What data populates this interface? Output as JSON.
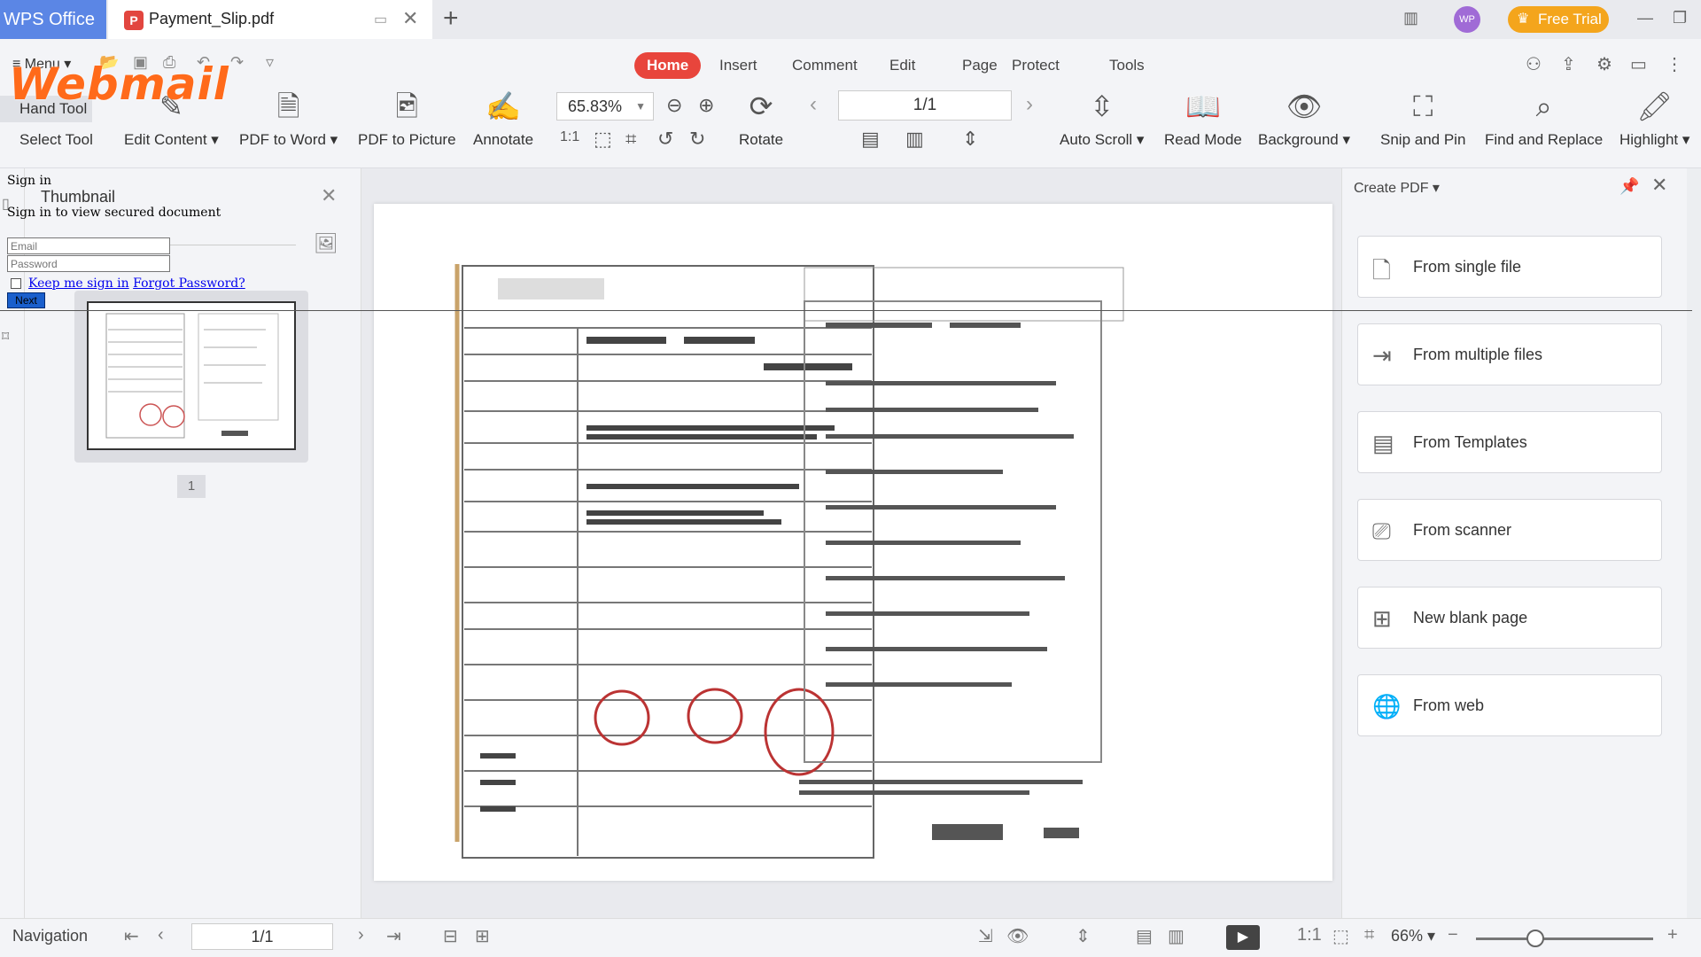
{
  "titlebar": {
    "app_name": "WPS Office",
    "doc_tab": "Payment_Slip.pdf",
    "avatar": "WP",
    "free_trial": "Free Trial"
  },
  "menu": {
    "label": "Menu"
  },
  "ribbon_tabs": [
    "Home",
    "Insert",
    "Comment",
    "Edit",
    "Page",
    "Protect",
    "Tools"
  ],
  "tools": {
    "hand_tool": "Hand Tool",
    "select_tool": "Select Tool",
    "edit_content": "Edit Content",
    "pdf_to_word": "PDF to Word",
    "pdf_to_picture": "PDF to Picture",
    "annotate": "Annotate",
    "zoom": "65.83%",
    "rotate": "Rotate",
    "page_indicator": "1/1",
    "auto_scroll": "Auto Scroll",
    "read_mode": "Read Mode",
    "background": "Background",
    "snip_and_pin": "Snip and Pin",
    "find_and_replace": "Find and Replace",
    "highlight": "Highlight"
  },
  "thumbnail": {
    "title": "Thumbnail",
    "page_number": "1"
  },
  "overlay": {
    "logo": "Webmail",
    "signin_title": "Sign in",
    "signin_message": "Sign in to view secured document",
    "email_placeholder": "Email",
    "password_placeholder": "Password",
    "keep_signed": "Keep me sign in",
    "forgot": "Forgot Password?",
    "next": "Next"
  },
  "right_panel": {
    "title": "Create PDF",
    "items": [
      "From single file",
      "From multiple files",
      "From Templates",
      "From scanner",
      "New blank page",
      "From web"
    ]
  },
  "statusbar": {
    "navigation": "Navigation",
    "page": "1/1",
    "zoom": "66%"
  },
  "colors": {
    "accent": "#e8453c",
    "tab_blue": "#5b86e5",
    "trial": "#f4a51c"
  }
}
